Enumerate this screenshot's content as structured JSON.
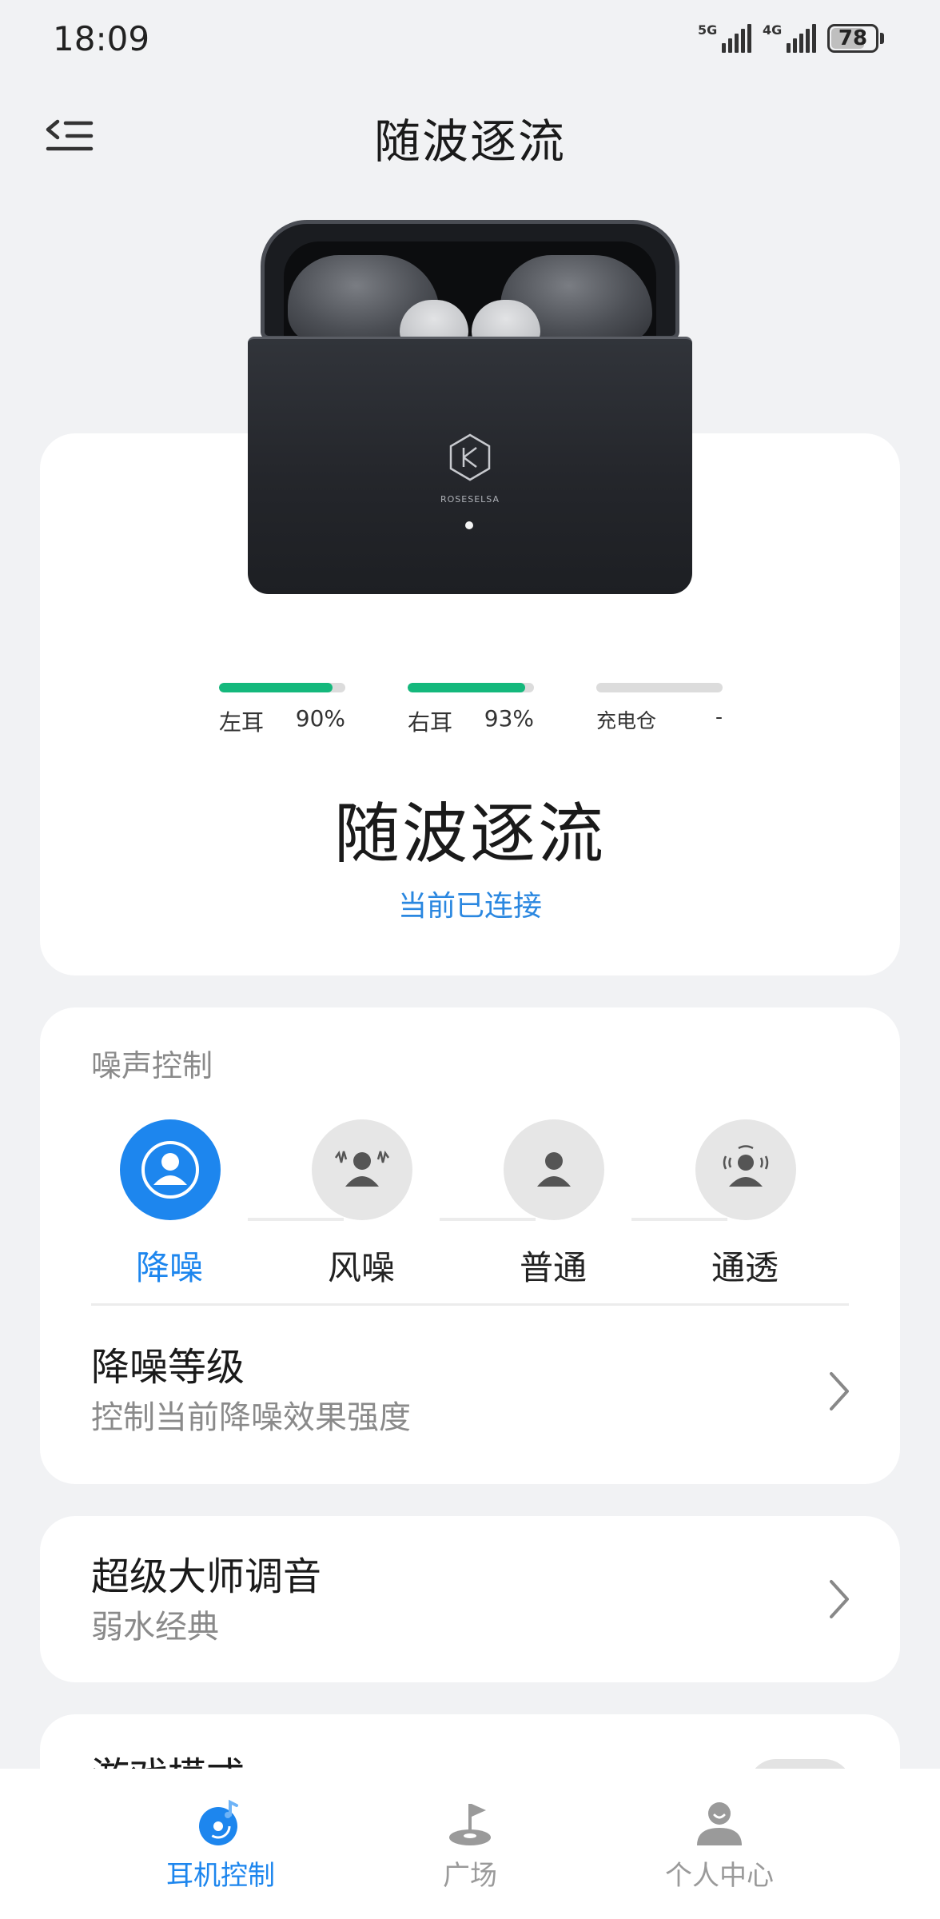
{
  "status_bar": {
    "time": "18:09",
    "network_1": "5G",
    "network_2": "4G",
    "battery": "78",
    "battery_level": 0.78
  },
  "header": {
    "title": "随波逐流",
    "menu_icon": "menu-collapse-icon"
  },
  "device": {
    "case_brand": "ROSESELSA",
    "name": "随波逐流",
    "status": "当前已连接",
    "levels": [
      {
        "label": "左耳",
        "value_text": "90%",
        "level": 0.9
      },
      {
        "label": "右耳",
        "value_text": "93%",
        "level": 0.93
      },
      {
        "label": "充电仓",
        "value_text": "-",
        "level": 0
      }
    ]
  },
  "noise_control": {
    "title": "噪声控制",
    "modes": [
      {
        "label": "降噪",
        "icon": "noise-cancel-icon",
        "active": true
      },
      {
        "label": "风噪",
        "icon": "wind-noise-icon",
        "active": false
      },
      {
        "label": "普通",
        "icon": "normal-mode-icon",
        "active": false
      },
      {
        "label": "通透",
        "icon": "transparency-icon",
        "active": false
      }
    ],
    "level_row": {
      "title": "降噪等级",
      "subtitle": "控制当前降噪效果强度"
    }
  },
  "eq": {
    "title": "超级大师调音",
    "subtitle": "弱水经典"
  },
  "game_mode": {
    "title": "游戏模式"
  },
  "bottom_nav": [
    {
      "label": "耳机控制",
      "icon": "headphone-control-icon",
      "active": true
    },
    {
      "label": "广场",
      "icon": "plaza-icon",
      "active": false
    },
    {
      "label": "个人中心",
      "icon": "profile-icon",
      "active": false
    }
  ],
  "colors": {
    "accent": "#1d86ee",
    "battery_green": "#14b87c",
    "status_blue": "#2a87e0"
  }
}
